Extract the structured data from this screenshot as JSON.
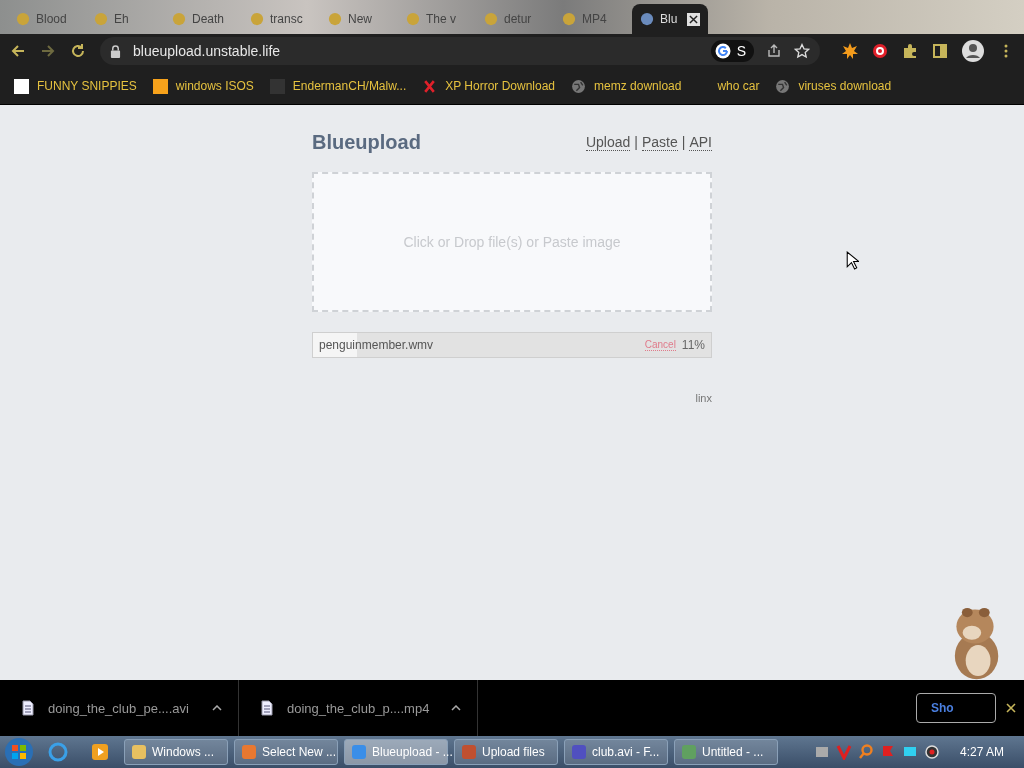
{
  "browser": {
    "tabs": [
      {
        "title": "Blood",
        "selected": false
      },
      {
        "title": "Eh",
        "selected": false
      },
      {
        "title": "Death",
        "selected": false
      },
      {
        "title": "transc",
        "selected": false
      },
      {
        "title": "New",
        "selected": false
      },
      {
        "title": "The v",
        "selected": false
      },
      {
        "title": "detur",
        "selected": false
      },
      {
        "title": "MP4",
        "selected": false
      },
      {
        "title": "Blu",
        "selected": true
      }
    ],
    "url": "blueupload.unstable.life",
    "account_chip": "S",
    "bookmarks": [
      {
        "title": "FUNNY SNIPPIES",
        "kind": "h"
      },
      {
        "title": "windows ISOS",
        "kind": "ph"
      },
      {
        "title": "EndermanCH/Malw...",
        "kind": "yp"
      },
      {
        "title": "XP Horror Download",
        "kind": "x"
      },
      {
        "title": "memz download",
        "kind": "globe"
      },
      {
        "title": "who car",
        "kind": "none"
      },
      {
        "title": "viruses download",
        "kind": "globe"
      }
    ]
  },
  "page": {
    "logo": "Blueupload",
    "nav": [
      "Upload",
      "Paste",
      "API"
    ],
    "separator": "|",
    "dropzone": "Click or Drop file(s) or Paste image",
    "upload": {
      "filename": "penguinmember.wmv",
      "cancel": "Cancel",
      "percent": "11%",
      "level": 0.11
    },
    "footer": "linx"
  },
  "downloads": {
    "items": [
      "doing_the_club_pe....avi",
      "doing_the_club_p....mp4"
    ],
    "show_all": "Sho"
  },
  "taskbar": {
    "items": [
      {
        "title": "Windows ...",
        "selected": false
      },
      {
        "title": "Select New ...",
        "selected": false
      },
      {
        "title": "Blueupload - ...",
        "selected": true
      },
      {
        "title": "Upload files",
        "selected": false
      },
      {
        "title": "club.avi - F...",
        "selected": false
      },
      {
        "title": "Untitled - ...",
        "selected": false
      }
    ],
    "clock": "4:27 AM"
  }
}
